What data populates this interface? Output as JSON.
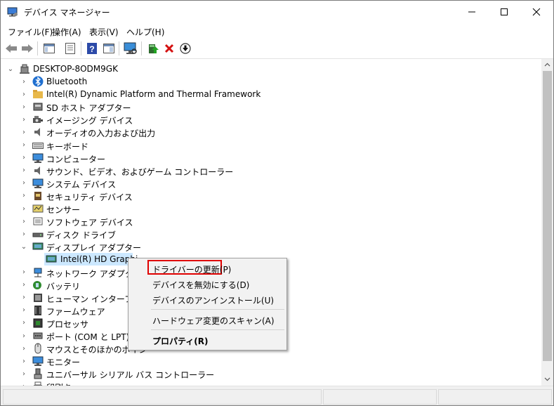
{
  "window": {
    "title": "デバイス マネージャー"
  },
  "menu": [
    "ファイル(F)",
    "操作(A)",
    "表示(V)",
    "ヘルプ(H)"
  ],
  "tree": {
    "root": "DESKTOP-8ODM9GK",
    "categories": [
      {
        "label": "Bluetooth",
        "icon": "bluetooth-icon"
      },
      {
        "label": "Intel(R) Dynamic Platform and Thermal Framework",
        "icon": "folder-icon"
      },
      {
        "label": "SD ホスト アダプター",
        "icon": "sd-card-icon"
      },
      {
        "label": "イメージング デバイス",
        "icon": "camera-icon"
      },
      {
        "label": "オーディオの入力および出力",
        "icon": "speaker-icon"
      },
      {
        "label": "キーボード",
        "icon": "keyboard-icon"
      },
      {
        "label": "コンピューター",
        "icon": "computer-icon"
      },
      {
        "label": "サウンド、ビデオ、およびゲーム コントローラー",
        "icon": "speaker-icon"
      },
      {
        "label": "システム デバイス",
        "icon": "monitor-icon"
      },
      {
        "label": "セキュリティ デバイス",
        "icon": "security-icon"
      },
      {
        "label": "センサー",
        "icon": "sensor-icon"
      },
      {
        "label": "ソフトウェア デバイス",
        "icon": "device-icon"
      },
      {
        "label": "ディスク ドライブ",
        "icon": "disk-drive-icon"
      },
      {
        "label": "ディスプレイ アダプター",
        "icon": "display-adapter-icon"
      },
      {
        "label": "Intel(R) HD Graphi",
        "icon": "display-adapter-icon"
      },
      {
        "label": "ネットワーク アダプター",
        "icon": "network-icon"
      },
      {
        "label": "バッテリ",
        "icon": "battery-icon"
      },
      {
        "label": "ヒューマン インターフェイス",
        "icon": "hid-icon"
      },
      {
        "label": "ファームウェア",
        "icon": "firmware-icon"
      },
      {
        "label": "プロセッサ",
        "icon": "processor-icon"
      },
      {
        "label": "ポート (COM と LPT)",
        "icon": "port-icon"
      },
      {
        "label": "マウスとそのほかのポイン",
        "icon": "mouse-icon"
      },
      {
        "label": "モニター",
        "icon": "monitor-icon"
      },
      {
        "label": "ユニバーサル シリアル バス コントローラー",
        "icon": "usb-icon"
      },
      {
        "label": "印刷キュー",
        "icon": "printer-icon"
      }
    ]
  },
  "context_menu": {
    "update_driver": "ドライバーの更新(P)",
    "disable_device": "デバイスを無効にする(D)",
    "uninstall_device": "デバイスのアンインストール(U)",
    "scan_hardware": "ハードウェア変更のスキャン(A)",
    "properties": "プロパティ(R)"
  },
  "colors": {
    "accent": "#0078d7",
    "highlight_box": "#e00000",
    "selection": "#cce8ff"
  }
}
